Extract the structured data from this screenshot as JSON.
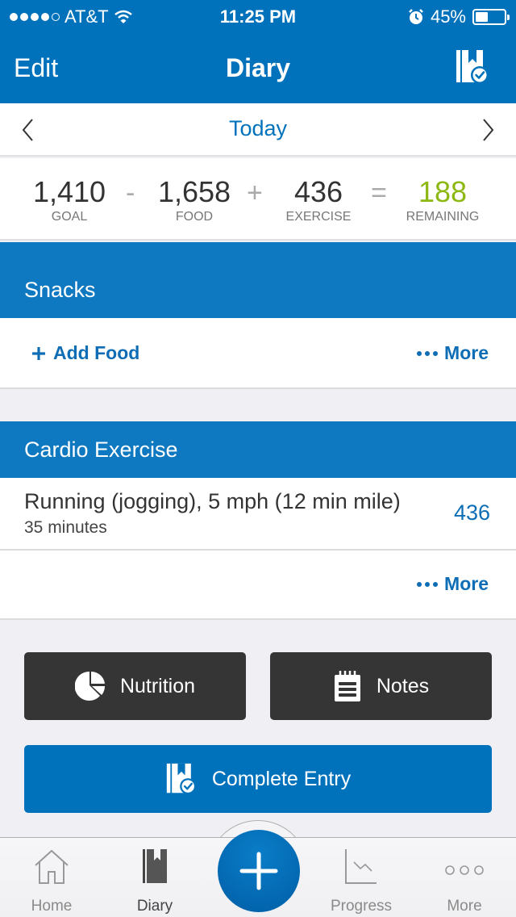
{
  "status_bar": {
    "carrier": "AT&T",
    "signal_bars_filled": 4,
    "signal_bars_total": 5,
    "time": "11:25 PM",
    "battery_percent_label": "45%",
    "battery_level": 0.45
  },
  "nav": {
    "edit_label": "Edit",
    "title": "Diary",
    "complete_icon": "diary-check-icon"
  },
  "date_nav": {
    "label": "Today",
    "prev_icon": "chevron-left-icon",
    "next_icon": "chevron-right-icon"
  },
  "summary": {
    "goal": {
      "value": "1,410",
      "label": "GOAL"
    },
    "food": {
      "value": "1,658",
      "label": "FOOD"
    },
    "exercise": {
      "value": "436",
      "label": "EXERCISE"
    },
    "remaining": {
      "value": "188",
      "label": "REMAINING"
    },
    "op_minus": "-",
    "op_plus": "+",
    "op_equals": "=",
    "remaining_color": "#8cb811"
  },
  "snacks": {
    "title": "Snacks",
    "add_food_label": "Add Food",
    "more_label": "More"
  },
  "cardio": {
    "title": "Cardio Exercise",
    "entries": [
      {
        "name": "Running (jogging), 5 mph (12 min mile)",
        "duration": "35 minutes",
        "calories": "436"
      }
    ],
    "more_label": "More"
  },
  "actions": {
    "nutrition_label": "Nutrition",
    "notes_label": "Notes",
    "complete_entry_label": "Complete Entry"
  },
  "tabbar": {
    "items": [
      {
        "label": "Home",
        "icon": "home-icon",
        "active": false
      },
      {
        "label": "Diary",
        "icon": "diary-icon",
        "active": true
      },
      {
        "label": "",
        "icon": "plus-icon",
        "active": false
      },
      {
        "label": "Progress",
        "icon": "chart-icon",
        "active": false
      },
      {
        "label": "More",
        "icon": "more-dots-icon",
        "active": false
      }
    ]
  },
  "colors": {
    "brand_blue": "#0072bc",
    "section_blue": "#0e78c0",
    "link_blue": "#0e6db4",
    "dark_button": "#353535",
    "remaining_green": "#8cb811"
  }
}
